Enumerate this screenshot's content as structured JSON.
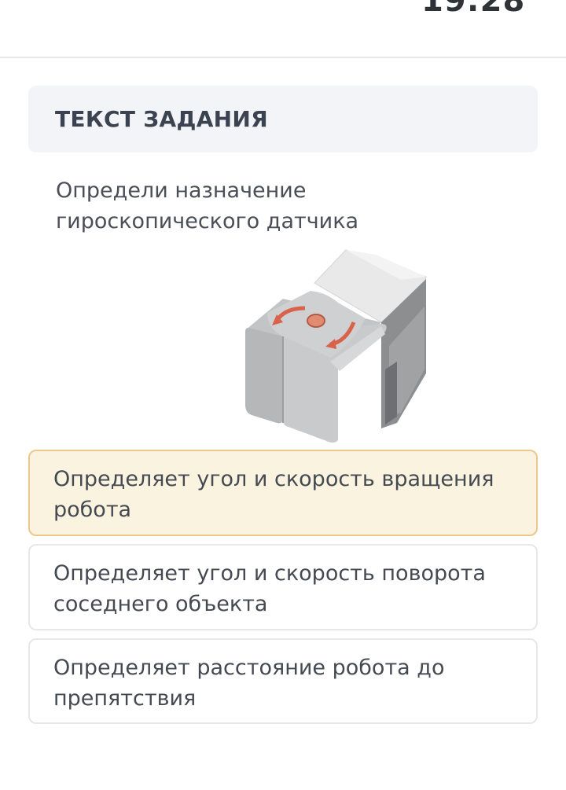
{
  "header": {
    "timer_text": "19:28"
  },
  "task": {
    "header_label": "ТЕКСТ ЗАДАНИЯ",
    "question_line1": "Определи назначение",
    "question_line2": "гироскопического датчика",
    "image_icon": "gyro-sensor-image"
  },
  "answers": [
    {
      "line1": "Определяет угол и скорость вращения",
      "line2": "робота",
      "selected": true
    },
    {
      "line1": "Определяет угол и скорость поворота",
      "line2": "соседнего объекта",
      "selected": false
    },
    {
      "line1": "Определяет расстояние робота до",
      "line2": "препятствия",
      "selected": false
    }
  ],
  "colors": {
    "selected_bg": "#faf3df",
    "selected_border": "#ecc88a",
    "header_bg": "#f3f4f8",
    "arrow_accent": "#d9634a"
  }
}
